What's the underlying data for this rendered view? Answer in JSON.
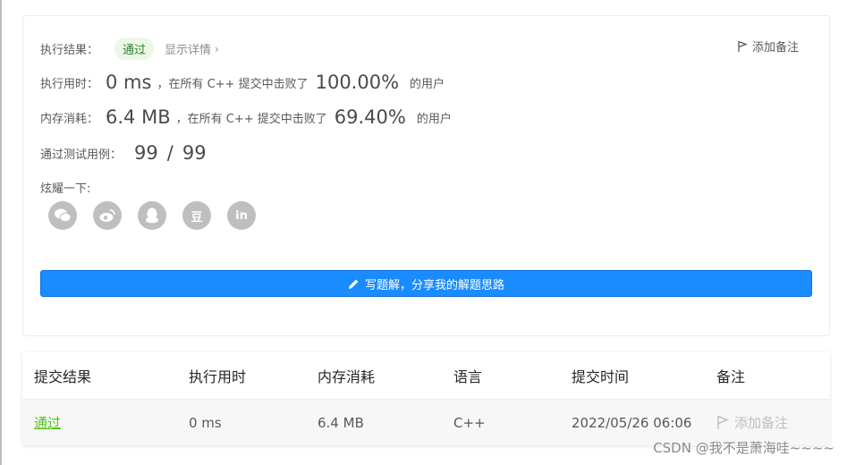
{
  "result": {
    "label": "执行结果：",
    "status": "通过",
    "detail_link": "显示详情",
    "add_note": "添加备注"
  },
  "runtime": {
    "label": "执行用时：",
    "value": "0 ms",
    "mid_text": "，在所有 C++ 提交中击败了",
    "percent": "100.00%",
    "suffix": "的用户"
  },
  "memory": {
    "label": "内存消耗：",
    "value": "6.4 MB",
    "mid_text": "，在所有 C++ 提交中击败了",
    "percent": "69.40%",
    "suffix": "的用户"
  },
  "tests": {
    "label": "通过测试用例：",
    "passed": "99",
    "separator": "/",
    "total": "99"
  },
  "share": {
    "label": "炫耀一下:",
    "icons": [
      "wechat-icon",
      "weibo-icon",
      "qq-icon",
      "douban-icon",
      "linkedin-icon"
    ],
    "douban_glyph": "豆",
    "linkedin_glyph": "in"
  },
  "write_button": "写题解，分享我的解题思路",
  "table": {
    "headers": [
      "提交结果",
      "执行用时",
      "内存消耗",
      "语言",
      "提交时间",
      "备注"
    ],
    "rows": [
      {
        "result": "通过",
        "runtime": "0 ms",
        "memory": "6.4 MB",
        "language": "C++",
        "time": "2022/05/26 06:06",
        "note": "添加备注"
      }
    ]
  },
  "watermark": "CSDN @我不是萧海哇~~~~",
  "colors": {
    "primary": "#1a8cff",
    "success": "#52c41a",
    "icon_gray": "#bfbfbf"
  }
}
